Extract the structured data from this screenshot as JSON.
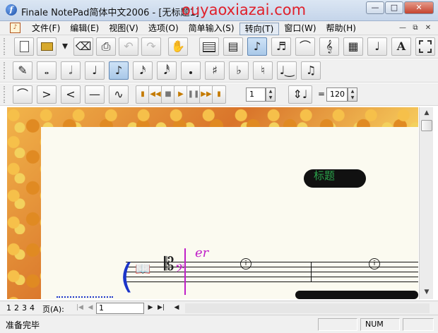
{
  "window": {
    "title": "Finale NotePad简体中文2006 - [无标题1]",
    "watermark": "ouyaoxiazai.com",
    "app_icon_letter": "f",
    "buttons": {
      "minimize": "—",
      "maximize": "□",
      "close": "✕"
    }
  },
  "menubar": {
    "items": [
      "文件(F)",
      "编辑(E)",
      "视图(V)",
      "选项(O)",
      "简单输入(S)",
      "转向(T)",
      "窗口(W)",
      "帮助(H)"
    ],
    "active": "转向(T)",
    "mdi_buttons": {
      "minimize": "—",
      "restore": "⧉",
      "close": "✕"
    }
  },
  "toolbar_main": {
    "icons": [
      "new-document",
      "open-folder",
      "dropdown",
      "eraser-tool",
      "print",
      "undo",
      "redo",
      "hand-grabber",
      "staff-tool",
      "measure-tool",
      "simple-entry-note",
      "tuplet-tool",
      "slur-tool",
      "clef-tool",
      "layout-tool",
      "articulation-tool",
      "text-tool",
      "selection-tool"
    ],
    "text_tool_label": "A"
  },
  "toolbar_notes": {
    "icons": [
      "eraser-note",
      "whole-note",
      "half-note",
      "quarter-note",
      "eighth-note",
      "sixteenth-note",
      "thirty-second-note",
      "augmentation-dot",
      "sharp",
      "flat",
      "natural",
      "tie",
      "triplet"
    ],
    "pressed": "eighth-note"
  },
  "toolbar_play": {
    "shapes": [
      "slur-shape",
      "crescendo",
      "decrescendo",
      "line",
      "curve"
    ],
    "playback": [
      "start",
      "rewind",
      "stop",
      "play",
      "pause",
      "forward",
      "end"
    ],
    "measure_value": "1",
    "tempo_equals": "=",
    "tempo_value": "120"
  },
  "score": {
    "title_text": "标题",
    "annotation": "er",
    "clef_glyph": "𝄡"
  },
  "navbar": {
    "page_tabs": [
      "1",
      "2",
      "3",
      "4"
    ],
    "page_label": "页(A):",
    "page_input": "1"
  },
  "status": {
    "text": "准备完毕",
    "indicator": "NUM"
  }
}
